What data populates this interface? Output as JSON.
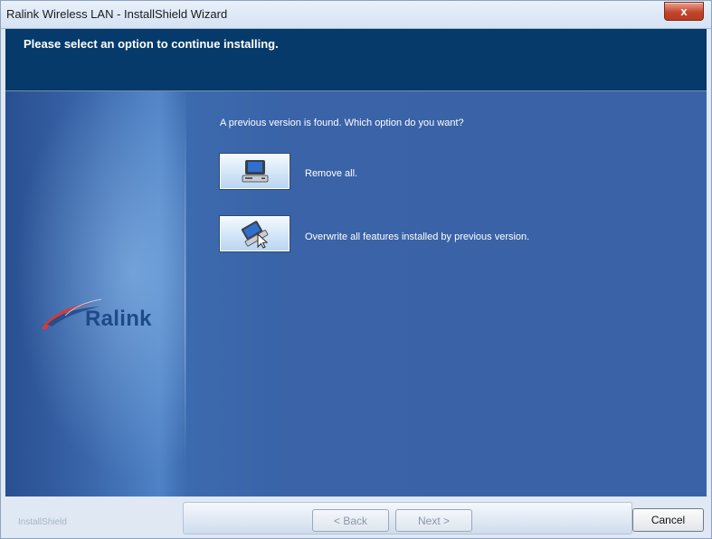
{
  "window": {
    "title": "Ralink Wireless LAN - InstallShield Wizard",
    "close_label": "x"
  },
  "header": {
    "text": "Please select an option to continue installing."
  },
  "main": {
    "question": "A previous version is found. Which option do you want?",
    "options": [
      {
        "label": "Remove all.",
        "icon": "computer-icon"
      },
      {
        "label": "Overwrite all features installed by previous version.",
        "icon": "laptop-cursor-icon"
      }
    ],
    "logo_text": "Ralink"
  },
  "footer": {
    "brand": "InstallShield",
    "back_label": "< Back",
    "next_label": "Next >",
    "cancel_label": "Cancel"
  },
  "colors": {
    "header_bg": "#053a6a",
    "main_bg": "#3a62a6",
    "logo_text": "#1e4a8a",
    "logo_swoosh": "#d63a3a"
  }
}
